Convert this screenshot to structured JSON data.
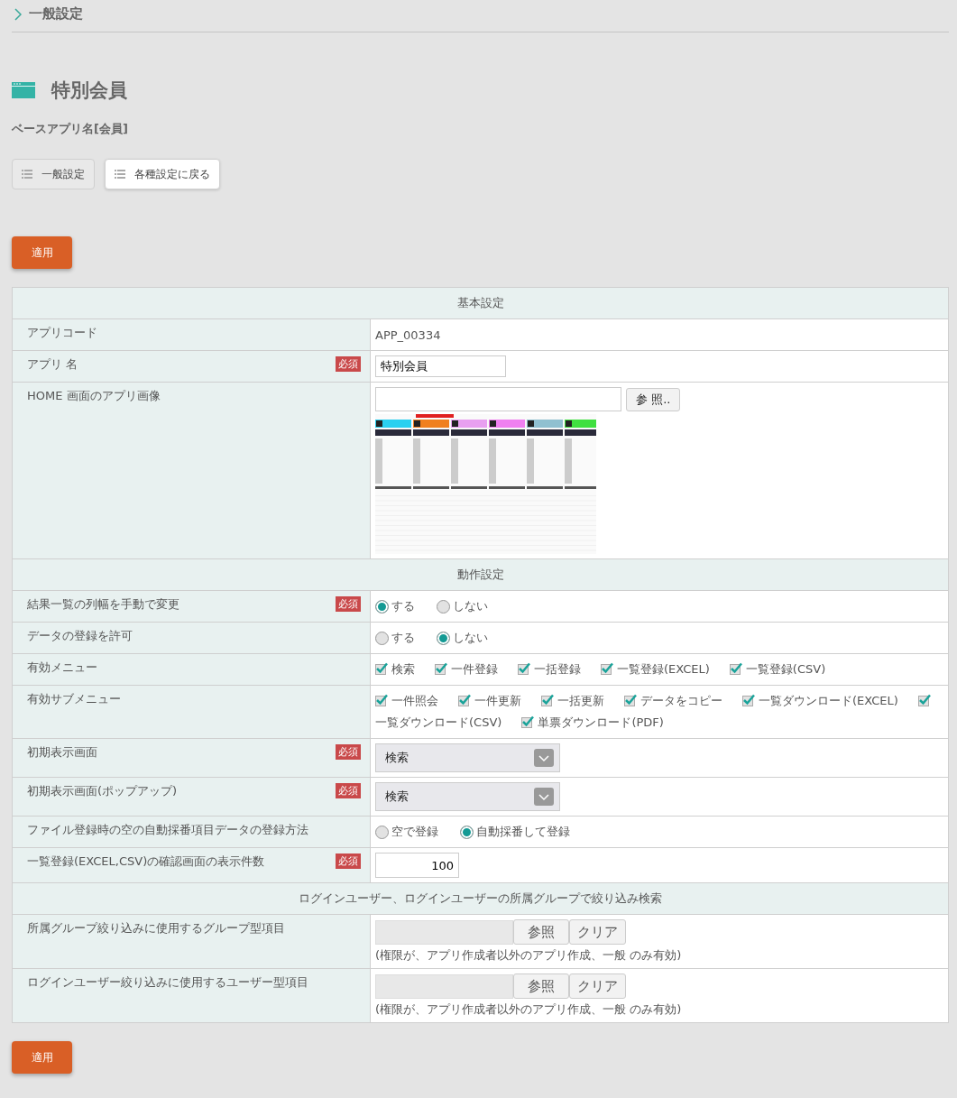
{
  "breadcrumb": {
    "label": "一般設定"
  },
  "page_title": "特別会員",
  "base_app": "ベースアプリ名[会員]",
  "nav_buttons": [
    {
      "label": "一般設定",
      "selected": true
    },
    {
      "label": "各種設定に戻る",
      "selected": false
    }
  ],
  "apply_button_top": "適用",
  "table": {
    "rows": [
      {
        "kind": "section",
        "title": "基本設定"
      },
      {
        "kind": "text",
        "label": "アプリコード",
        "value": "APP_00334"
      },
      {
        "kind": "input",
        "label": "アプリ 名",
        "badge": "必須",
        "value": "特別会員"
      },
      {
        "kind": "file",
        "label": "HOME 画面のアプリ画像",
        "button": "参 照.."
      },
      {
        "kind": "section",
        "title": "動作設定"
      },
      {
        "kind": "radio",
        "label": "結果一覧の列幅を手動で変更",
        "badge": "必須",
        "options": [
          {
            "label": "する",
            "selected": true
          },
          {
            "label": "しない",
            "selected": false
          }
        ]
      },
      {
        "kind": "radio",
        "label": "データの登録を許可",
        "options": [
          {
            "label": "する",
            "selected": false
          },
          {
            "label": "しない",
            "selected": true
          }
        ]
      },
      {
        "kind": "checkbox",
        "label": "有効メニュー",
        "options": [
          {
            "label": "検索",
            "checked": true
          },
          {
            "label": "一件登録",
            "checked": true
          },
          {
            "label": "一括登録",
            "checked": true
          },
          {
            "label": "一覧登録(EXCEL)",
            "checked": true
          },
          {
            "label": "一覧登録(CSV)",
            "checked": true
          }
        ]
      },
      {
        "kind": "checkbox",
        "label": "有効サブメニュー",
        "options": [
          {
            "label": "一件照会",
            "checked": true
          },
          {
            "label": "一件更新",
            "checked": true
          },
          {
            "label": "一括更新",
            "checked": true
          },
          {
            "label": "データをコピー",
            "checked": true
          },
          {
            "label": "一覧ダウンロード(EXCEL)",
            "checked": true
          },
          {
            "label": "一覧ダウンロード(CSV)",
            "checked": true
          },
          {
            "label": "単票ダウンロード(PDF)",
            "checked": true
          }
        ]
      },
      {
        "kind": "select",
        "label": "初期表示画面",
        "badge": "必須",
        "value": "検索"
      },
      {
        "kind": "select",
        "label": "初期表示画面(ポップアップ)",
        "badge": "必須",
        "value": "検索"
      },
      {
        "kind": "radio",
        "label": "ファイル登録時の空の自動採番項目データの登録方法",
        "options": [
          {
            "label": "空で登録",
            "selected": false
          },
          {
            "label": "自動採番して登録",
            "selected": true
          }
        ]
      },
      {
        "kind": "number",
        "label": "一覧登録(EXCEL,CSV)の確認画面の表示件数",
        "badge": "必須",
        "value": "100"
      },
      {
        "kind": "section",
        "title": "ログインユーザー、ログインユーザーの所属グループで絞り込み検索"
      },
      {
        "kind": "picker",
        "label": "所属グループ絞り込みに使用するグループ型項目",
        "buttons": [
          "参照",
          "クリア"
        ],
        "note": "(権限が、アプリ作成者以外のアプリ作成、一般 のみ有効)"
      },
      {
        "kind": "picker",
        "label": "ログインユーザー絞り込みに使用するユーザー型項目",
        "buttons": [
          "参照",
          "クリア"
        ],
        "note": "(権限が、アプリ作成者以外のアプリ作成、一般 のみ有効)"
      }
    ]
  },
  "apply_button_bottom": "適用"
}
